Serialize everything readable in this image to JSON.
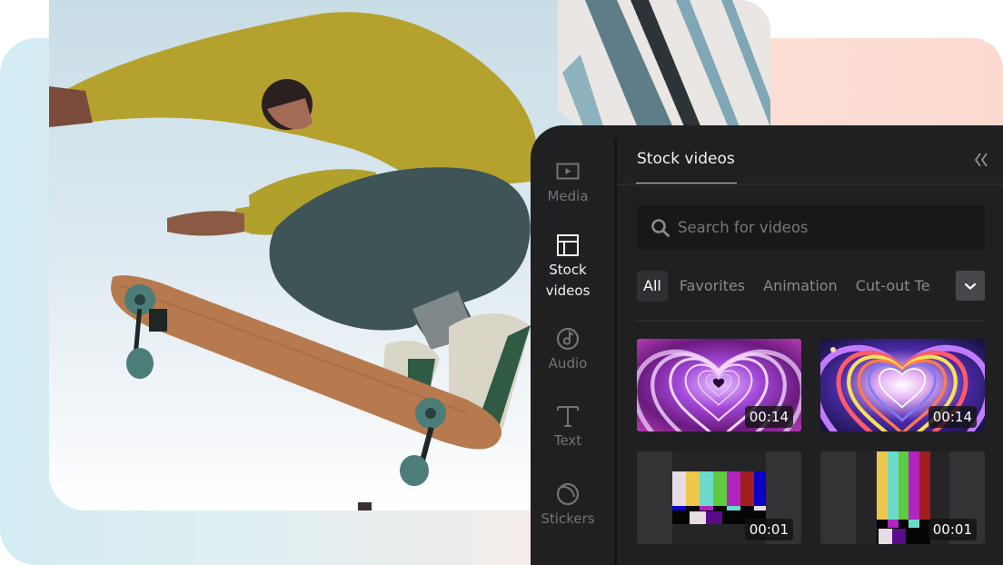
{
  "sidebar": {
    "items": [
      {
        "id": "media",
        "label": "Media",
        "icon": "play-frame-icon",
        "active": false
      },
      {
        "id": "stock-videos",
        "label": "Stock\nvideos",
        "label_line1": "Stock",
        "label_line2": "videos",
        "icon": "layout-icon",
        "active": true
      },
      {
        "id": "audio",
        "label": "Audio",
        "icon": "music-note-icon",
        "active": false
      },
      {
        "id": "text",
        "label": "Text",
        "icon": "text-t-icon",
        "active": false
      },
      {
        "id": "stickers",
        "label": "Stickers",
        "icon": "sticker-icon",
        "active": false
      }
    ]
  },
  "panel": {
    "title": "Stock videos",
    "collapse_icon": "double-chevron-left-icon",
    "search": {
      "placeholder": "Search for videos",
      "value": ""
    },
    "categories": [
      "All",
      "Favorites",
      "Animation",
      "Cut-out Te"
    ],
    "selected_category": "All",
    "more_icon": "chevron-down-icon"
  },
  "videos": [
    {
      "name": "pink-neon-hearts",
      "duration": "00:14"
    },
    {
      "name": "rainbow-neon-hearts",
      "duration": "00:14"
    },
    {
      "name": "color-bars-horizontal",
      "duration": "00:01"
    },
    {
      "name": "color-bars-vertical",
      "duration": "00:01"
    }
  ],
  "colors": {
    "panel_bg": "#202022",
    "accent_text": "#f0f0f0",
    "muted_text": "#737377",
    "backdrop_blue": "#d3ecf3",
    "backdrop_peach": "#fcd9ce"
  }
}
